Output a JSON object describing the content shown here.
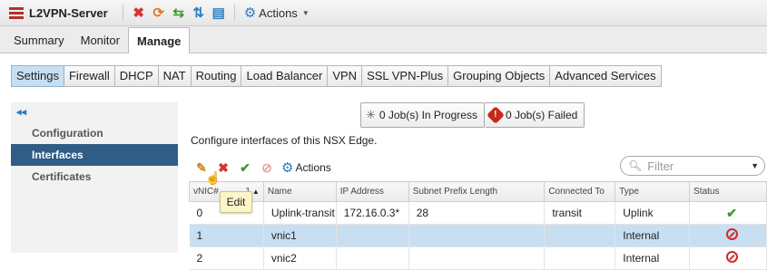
{
  "titlebar": {
    "title": "L2VPN-Server",
    "actions_label": "Actions"
  },
  "top_tabs": [
    {
      "label": "Summary",
      "active": false
    },
    {
      "label": "Monitor",
      "active": false
    },
    {
      "label": "Manage",
      "active": true
    }
  ],
  "sub_tabs": [
    {
      "label": "Settings",
      "active": true
    },
    {
      "label": "Firewall"
    },
    {
      "label": "DHCP"
    },
    {
      "label": "NAT"
    },
    {
      "label": "Routing"
    },
    {
      "label": "Load Balancer"
    },
    {
      "label": "VPN"
    },
    {
      "label": "SSL VPN-Plus"
    },
    {
      "label": "Grouping Objects"
    },
    {
      "label": "Advanced Services"
    }
  ],
  "left_nav": {
    "items": [
      {
        "label": "Configuration",
        "active": false
      },
      {
        "label": "Interfaces",
        "active": true
      },
      {
        "label": "Certificates",
        "active": false
      }
    ]
  },
  "jobs": {
    "in_progress": "0 Job(s) In Progress",
    "failed": "0 Job(s) Failed"
  },
  "description": "Configure interfaces of this NSX Edge.",
  "grid_toolbar": {
    "actions_label": "Actions",
    "tooltip": "Edit"
  },
  "filter": {
    "placeholder": "Filter"
  },
  "table": {
    "headers": [
      "vNIC#",
      "1",
      "Name",
      "IP Address",
      "Subnet Prefix Length",
      "Connected To",
      "Type",
      "Status"
    ],
    "rows": [
      {
        "vnic": "0",
        "name": "Uplink-transit",
        "ip": "172.16.0.3*",
        "prefix": "28",
        "connected": "transit",
        "type": "Uplink",
        "status": "connected"
      },
      {
        "vnic": "1",
        "name": "vnic1",
        "ip": "",
        "prefix": "",
        "connected": "",
        "type": "Internal",
        "status": "disconnected",
        "selected": true
      },
      {
        "vnic": "2",
        "name": "vnic2",
        "ip": "",
        "prefix": "",
        "connected": "",
        "type": "Internal",
        "status": "disconnected"
      }
    ]
  },
  "colors": {
    "accent_blue": "#2d78c4",
    "nav_active": "#2f5d86",
    "selection": "#c7dff1",
    "error_red": "#d8322b",
    "success_green": "#3a9a2c"
  },
  "icons": [
    "edge-icon",
    "delete-icon",
    "refresh-icon",
    "migrate-icon",
    "sync-icon",
    "report-icon",
    "gear-icon",
    "pencil-icon",
    "checkmark-icon",
    "disabled-icon",
    "spinner-icon",
    "error-icon",
    "search-icon"
  ]
}
